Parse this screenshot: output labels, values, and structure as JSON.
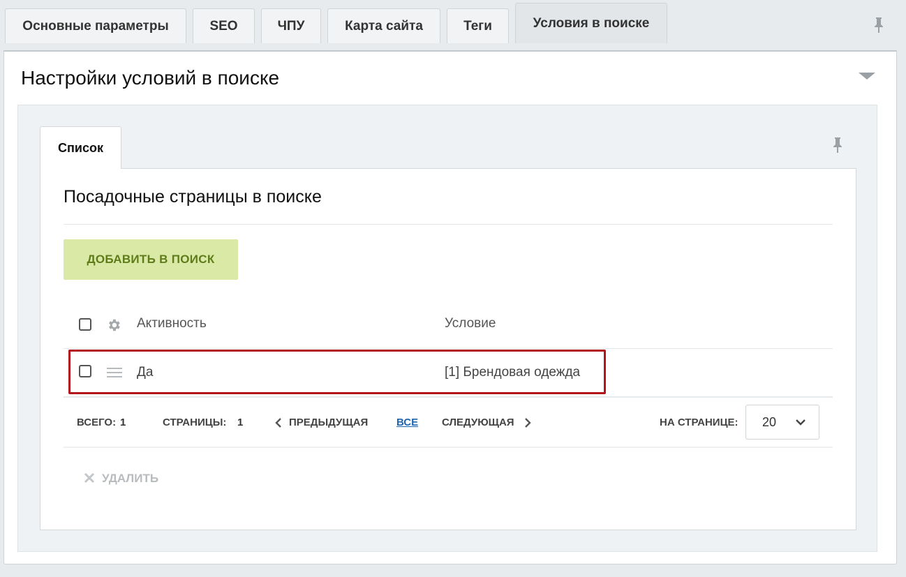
{
  "tabs": [
    {
      "label": "Основные параметры",
      "active": false
    },
    {
      "label": "SEO",
      "active": false
    },
    {
      "label": "ЧПУ",
      "active": false
    },
    {
      "label": "Карта сайта",
      "active": false
    },
    {
      "label": "Теги",
      "active": false
    },
    {
      "label": "Условия в поиске",
      "active": true
    }
  ],
  "panel": {
    "title": "Настройки условий в поиске"
  },
  "list_tab": {
    "label": "Список"
  },
  "card": {
    "title": "Посадочные страницы в поиске",
    "add_button": "ДОБАВИТЬ В ПОИСК"
  },
  "table": {
    "columns": [
      "Активность",
      "Условие"
    ],
    "rows": [
      {
        "active": "Да",
        "condition": "[1] Брендовая одежда"
      }
    ]
  },
  "footer": {
    "total_label": "ВСЕГО:",
    "total_value": "1",
    "pages_label": "СТРАНИЦЫ:",
    "pages_value": "1",
    "prev": "ПРЕДЫДУЩАЯ",
    "all": "ВСЕ",
    "next": "СЛЕДУЮЩАЯ",
    "per_page_label": "НА СТРАНИЦЕ:",
    "per_page_value": "20"
  },
  "delete_label": "УДАЛИТЬ",
  "colors": {
    "highlight": "#b2151c",
    "add_button_bg": "#dae9a6",
    "link": "#2067b0"
  }
}
